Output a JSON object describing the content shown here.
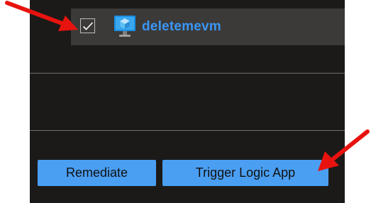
{
  "resource": {
    "name": "deletemevm",
    "selected": true,
    "icon": "virtual-machine-icon"
  },
  "actions": {
    "remediate_label": "Remediate",
    "trigger_label": "Trigger Logic App"
  },
  "colors": {
    "panel_bg": "#1b1a19",
    "row_bg": "#3b3a39",
    "link_blue": "#3a96f5",
    "button_blue": "#4a9ff3",
    "annotation_red": "#e8130f"
  }
}
